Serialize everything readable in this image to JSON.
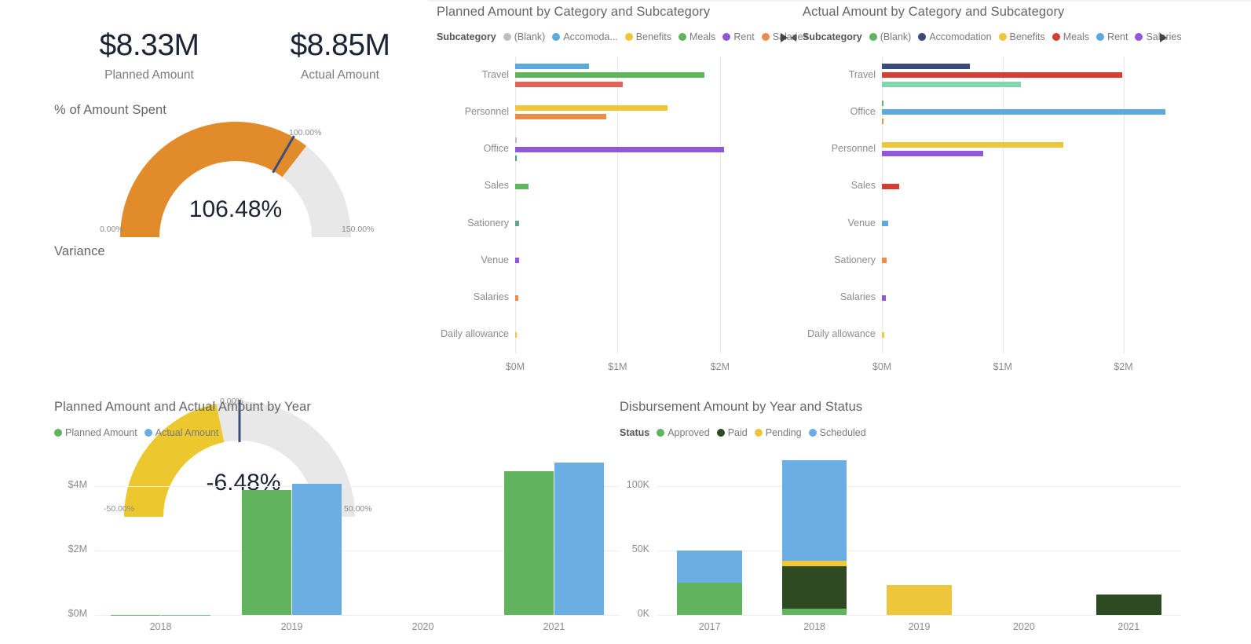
{
  "kpis": [
    {
      "value": "$8.33M",
      "label": "Planned Amount"
    },
    {
      "value": "$8.85M",
      "label": "Actual Amount"
    }
  ],
  "gauges": [
    {
      "title": "% of Amount Spent",
      "value_label": "106.48%",
      "value": 106.48,
      "min": 0,
      "max": 150,
      "min_label": "0.00%",
      "max_label": "150.00%",
      "target": 100,
      "target_label": "100.00%",
      "color": "#e28b2a",
      "track": "#e8e8e8",
      "target_color": "#3b4f7d"
    },
    {
      "title": "Variance",
      "value_label": "-6.48%",
      "value": -6.48,
      "min": -50,
      "max": 50,
      "min_label": "-50.00%",
      "max_label": "50.00%",
      "target": 0,
      "target_label": "0.00%",
      "color": "#ecc82e",
      "track": "#e8e8e8",
      "target_color": "#3b4f7d"
    }
  ],
  "chart_data": [
    {
      "type": "bar",
      "orientation": "horizontal",
      "title": "Planned Amount by Category and Subcategory",
      "legend_title": "Subcategory",
      "legend_position": "top",
      "legend": [
        {
          "name": "(Blank)",
          "color": "#bfbfbf"
        },
        {
          "name": "Accomoda...",
          "color": "#5ca9e0"
        },
        {
          "name": "Benefits",
          "color": "#edc63b"
        },
        {
          "name": "Meals",
          "color": "#61b35e"
        },
        {
          "name": "Rent",
          "color": "#9257d8"
        },
        {
          "name": "Salaries",
          "color": "#ed8c4a"
        }
      ],
      "next_page_icon": "triangle-right-icon",
      "categories": [
        "Travel",
        "Personnel",
        "Office",
        "Sales",
        "Sationery",
        "Venue",
        "Salaries",
        "Daily allowance"
      ],
      "xlabel": "",
      "ylabel": "",
      "xlim": [
        0,
        2.3
      ],
      "xticks": [
        "$0M",
        "$1M",
        "$2M"
      ],
      "xtick_values": [
        0,
        1,
        2
      ],
      "bars": [
        {
          "category": "Travel",
          "subcategory": "Accomoda...",
          "color": "#5ca9e0",
          "value": 0.72
        },
        {
          "category": "Travel",
          "subcategory": "Meals",
          "color": "#61b35e",
          "value": 1.85
        },
        {
          "category": "Travel",
          "subcategory": "Salaries-red",
          "color": "#e0645c",
          "value": 1.05
        },
        {
          "category": "Personnel",
          "subcategory": "Benefits",
          "color": "#edc63b",
          "value": 1.49
        },
        {
          "category": "Personnel",
          "subcategory": "Salaries",
          "color": "#ed8c4a",
          "value": 0.89
        },
        {
          "category": "Office",
          "subcategory": "(Blank)",
          "color": "#bfbfbf",
          "value": 0.012
        },
        {
          "category": "Office",
          "subcategory": "Rent",
          "color": "#9257d8",
          "value": 2.04
        },
        {
          "category": "Office",
          "subcategory": "teal",
          "color": "#4fa089",
          "value": 0.018
        },
        {
          "category": "Sales",
          "subcategory": "Meals",
          "color": "#61b35e",
          "value": 0.13
        },
        {
          "category": "Sationery",
          "subcategory": "teal",
          "color": "#63a391",
          "value": 0.042
        },
        {
          "category": "Venue",
          "subcategory": "Rent",
          "color": "#9257d8",
          "value": 0.035
        },
        {
          "category": "Salaries",
          "subcategory": "Salaries",
          "color": "#ed8c4a",
          "value": 0.028
        },
        {
          "category": "Daily allowance",
          "subcategory": "Benefits",
          "color": "#edc63b",
          "value": 0.016
        }
      ]
    },
    {
      "type": "bar",
      "orientation": "horizontal",
      "title": "Actual Amount by Category and Subcategory",
      "legend_title": "Subcategory",
      "legend_position": "top",
      "legend": [
        {
          "name": "(Blank)",
          "color": "#61b35e"
        },
        {
          "name": "Accomodation",
          "color": "#3b4a7d"
        },
        {
          "name": "Benefits",
          "color": "#edc63b"
        },
        {
          "name": "Meals",
          "color": "#d23f34"
        },
        {
          "name": "Rent",
          "color": "#5ca9e0"
        },
        {
          "name": "Salaries",
          "color": "#9257d8"
        }
      ],
      "prev_page_icon": "triangle-left-icon",
      "next_page_icon": "triangle-right-icon",
      "categories": [
        "Travel",
        "Office",
        "Personnel",
        "Sales",
        "Venue",
        "Sationery",
        "Salaries",
        "Daily allowance"
      ],
      "xlabel": "",
      "ylabel": "",
      "xlim": [
        0,
        2.4
      ],
      "xticks": [
        "$0M",
        "$1M",
        "$2M"
      ],
      "xtick_values": [
        0,
        1,
        2
      ],
      "bars": [
        {
          "category": "Travel",
          "subcategory": "Accomodation",
          "color": "#3b4a7d",
          "value": 0.73
        },
        {
          "category": "Travel",
          "subcategory": "Meals",
          "color": "#d23f34",
          "value": 1.99
        },
        {
          "category": "Travel",
          "subcategory": "mint",
          "color": "#84d6b0",
          "value": 1.15
        },
        {
          "category": "Office",
          "subcategory": "(Blank)",
          "color": "#61b35e",
          "value": 0.012
        },
        {
          "category": "Office",
          "subcategory": "Rent",
          "color": "#5ca9e0",
          "value": 2.35
        },
        {
          "category": "Office",
          "subcategory": "orange",
          "color": "#ed8c4a",
          "value": 0.014
        },
        {
          "category": "Personnel",
          "subcategory": "Benefits",
          "color": "#edc63b",
          "value": 1.5
        },
        {
          "category": "Personnel",
          "subcategory": "Salaries",
          "color": "#9257d8",
          "value": 0.84
        },
        {
          "category": "Sales",
          "subcategory": "Meals",
          "color": "#d23f34",
          "value": 0.145
        },
        {
          "category": "Venue",
          "subcategory": "Rent",
          "color": "#5ca9e0",
          "value": 0.05
        },
        {
          "category": "Sationery",
          "subcategory": "orange",
          "color": "#ed8c4a",
          "value": 0.038
        },
        {
          "category": "Salaries",
          "subcategory": "Salaries",
          "color": "#9257d8",
          "value": 0.03
        },
        {
          "category": "Daily allowance",
          "subcategory": "Benefits",
          "color": "#edc63b",
          "value": 0.02
        }
      ]
    },
    {
      "type": "bar",
      "orientation": "vertical",
      "grouped": true,
      "title": "Planned Amount and Actual Amount by Year",
      "legend_position": "top",
      "legend": [
        {
          "name": "Planned Amount",
          "color": "#61b35e"
        },
        {
          "name": "Actual Amount",
          "color": "#6aaee4"
        }
      ],
      "categories": [
        "2018",
        "2019",
        "2020",
        "2021"
      ],
      "xlabel": "",
      "ylabel": "",
      "ylim": [
        0,
        5.2
      ],
      "yticks": [
        "$0M",
        "$2M",
        "$4M"
      ],
      "ytick_values": [
        0,
        2,
        4
      ],
      "series": [
        {
          "name": "Planned Amount",
          "color": "#61b35e",
          "values": [
            0.01,
            3.87,
            0,
            4.46
          ]
        },
        {
          "name": "Actual Amount",
          "color": "#6aaee4",
          "values": [
            0.01,
            4.08,
            0,
            4.73
          ]
        }
      ]
    },
    {
      "type": "bar",
      "orientation": "vertical",
      "stacked": true,
      "title": "Disbursement Amount by Year and Status",
      "legend_title": "Status",
      "legend_position": "top",
      "legend": [
        {
          "name": "Approved",
          "color": "#61b35e"
        },
        {
          "name": "Paid",
          "color": "#2e4a23"
        },
        {
          "name": "Pending",
          "color": "#edc63b"
        },
        {
          "name": "Scheduled",
          "color": "#6aaee4"
        }
      ],
      "categories": [
        "2017",
        "2018",
        "2019",
        "2020",
        "2021"
      ],
      "xlabel": "",
      "ylabel": "",
      "ylim": [
        0,
        130
      ],
      "yticks": [
        "0K",
        "50K",
        "100K"
      ],
      "ytick_values": [
        0,
        50,
        100
      ],
      "series": [
        {
          "name": "Approved",
          "color": "#61b35e",
          "values": [
            25,
            5,
            0,
            0,
            0
          ]
        },
        {
          "name": "Paid",
          "color": "#2e4a23",
          "values": [
            0,
            33,
            0,
            0,
            16
          ]
        },
        {
          "name": "Pending",
          "color": "#edc63b",
          "values": [
            0,
            4,
            23,
            0,
            0
          ]
        },
        {
          "name": "Scheduled",
          "color": "#6aaee4",
          "values": [
            25,
            78,
            0,
            0,
            0
          ]
        }
      ]
    }
  ]
}
